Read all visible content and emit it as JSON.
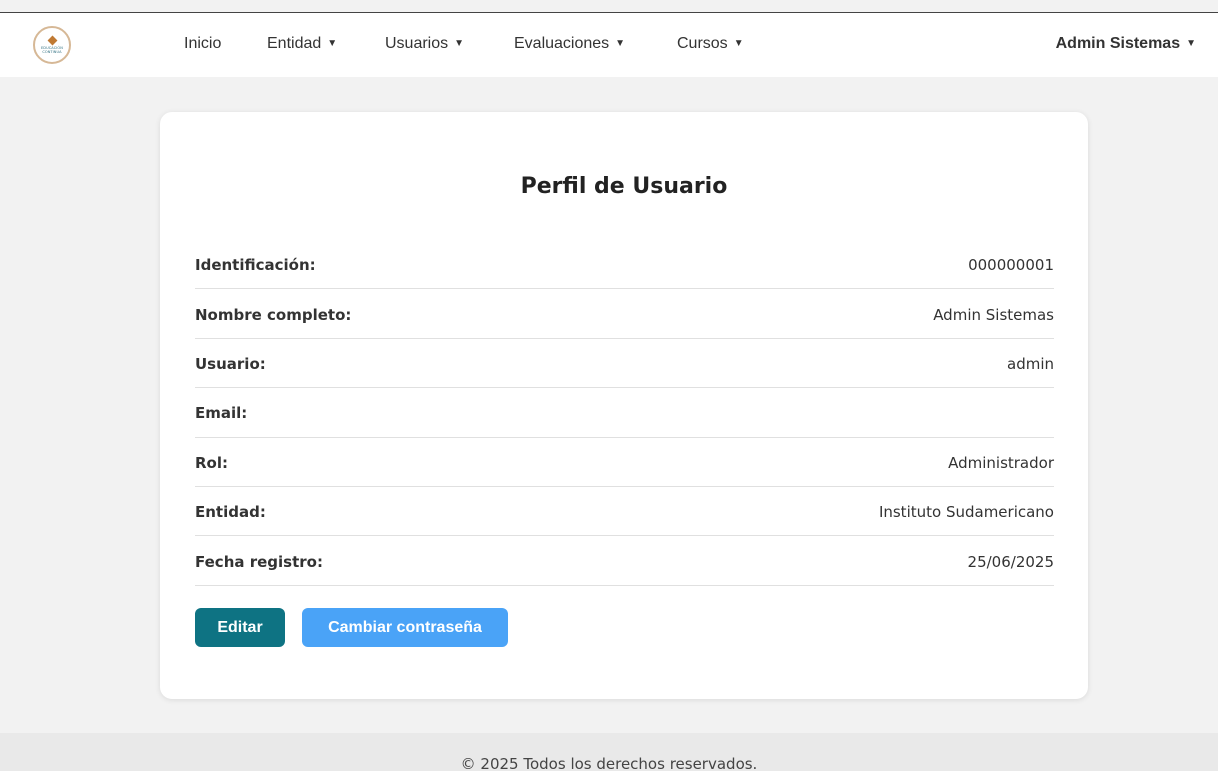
{
  "brand": {
    "logo_line1": "EDUCACIÓN",
    "logo_line2": "CONTINUA"
  },
  "nav": {
    "items": [
      {
        "label": "Inicio",
        "dropdown": false
      },
      {
        "label": "Entidad",
        "dropdown": true
      },
      {
        "label": "Usuarios",
        "dropdown": true
      },
      {
        "label": "Evaluaciones",
        "dropdown": true
      },
      {
        "label": "Cursos",
        "dropdown": true
      }
    ],
    "user": "Admin Sistemas",
    "caret": "▼"
  },
  "profile": {
    "title": "Perfil de Usuario",
    "fields": [
      {
        "label": "Identificación:",
        "value": "000000001"
      },
      {
        "label": "Nombre completo:",
        "value": "Admin Sistemas"
      },
      {
        "label": "Usuario:",
        "value": "admin"
      },
      {
        "label": "Email:",
        "value": ""
      },
      {
        "label": "Rol:",
        "value": "Administrador"
      },
      {
        "label": "Entidad:",
        "value": "Instituto Sudamericano"
      },
      {
        "label": "Fecha registro:",
        "value": "25/06/2025"
      }
    ],
    "edit_label": "Editar",
    "change_password_label": "Cambiar contraseña"
  },
  "footer": {
    "text": "© 2025 Todos los derechos reservados."
  },
  "colors": {
    "primary_button": "#0e7383",
    "secondary_button": "#4aa3f7",
    "background": "#f2f2f2"
  }
}
